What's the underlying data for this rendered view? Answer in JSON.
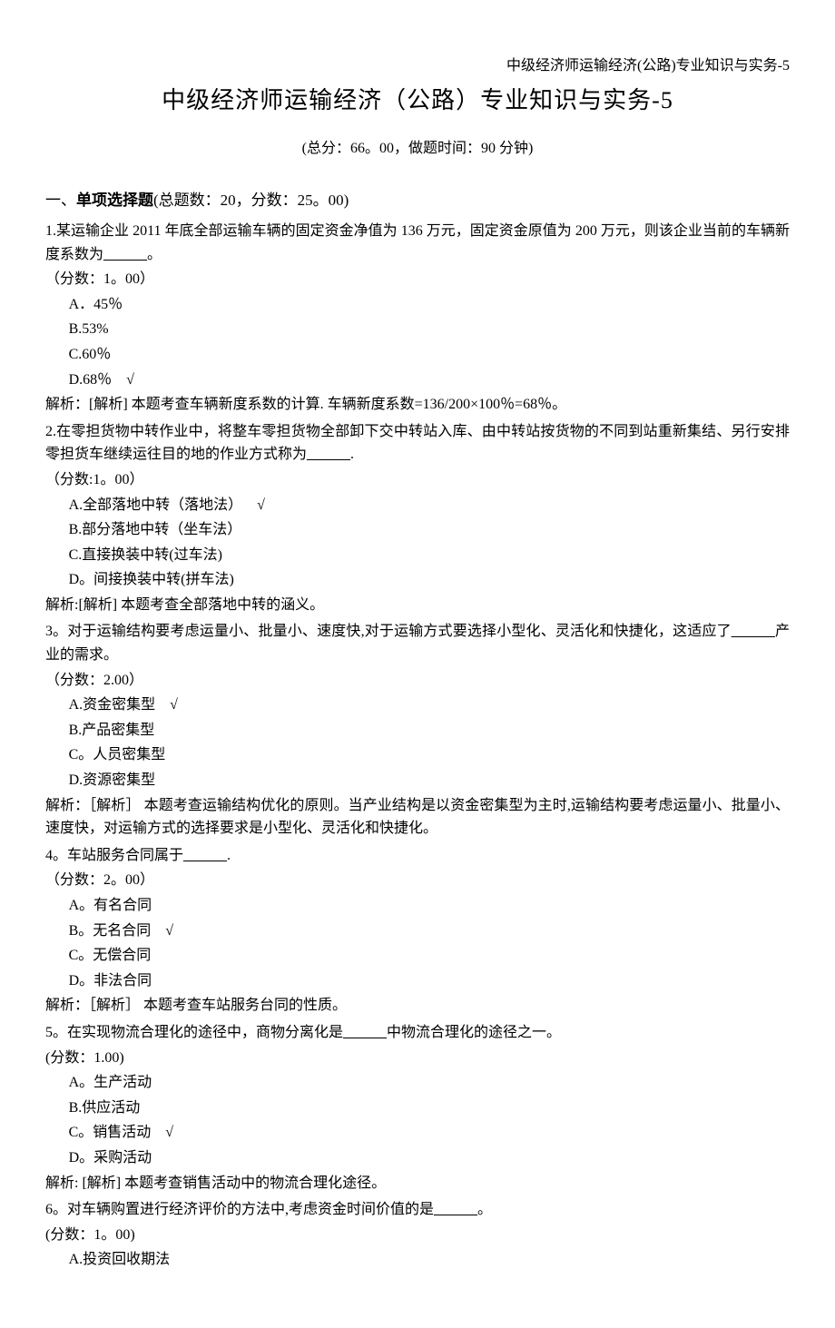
{
  "header_right": "中级经济师运输经济(公路)专业知识与实务-5",
  "title": "中级经济师运输经济（公路）专业知识与实务-5",
  "meta": "(总分：66。00，做题时间：90 分钟)",
  "section_prefix": "一、",
  "section_bold": "单项选择题",
  "section_detail": "(总题数：20，分数：25。00)",
  "check_mark": "√",
  "blank_text": "______",
  "q1": {
    "stem_a": "1.某运输企业 2011 年底全部运输车辆的固定资金净值为 136 万元，固定资金原值为 200 万元，则该企业当前的车辆新度系数为",
    "stem_b": "。",
    "score": "（分数：1。00）",
    "optA": "A．45％",
    "optB": "B.53%",
    "optC": "C.60％",
    "optD": "D.68％",
    "analysis": "解析：[解析] 本题考查车辆新度系数的计算. 车辆新度系数=136/200×100％=68％。"
  },
  "q2": {
    "stem_a": "2.在零担货物中转作业中，将整车零担货物全部卸下交中转站入库、由中转站按货物的不同到站重新集结、另行安排零担货车继续运往目的地的作业方式称为",
    "stem_b": ".",
    "score": "（分数:1。00）",
    "optA": "A.全部落地中转（落地法）",
    "optB": "B.部分落地中转（坐车法）",
    "optC": "C.直接换装中转(过车法)",
    "optD": "D。间接换装中转(拼车法)",
    "analysis": "解析:[解析] 本题考查全部落地中转的涵义。"
  },
  "q3": {
    "stem_a": "3。对于运输结构要考虑运量小、批量小、速度快,对于运输方式要选择小型化、灵活化和快捷化，这适应了",
    "stem_b": "产业的需求。",
    "score": "（分数：2.00）",
    "optA": "A.资金密集型",
    "optB": "B.产品密集型",
    "optC": "C。人员密集型",
    "optD": "D.资源密集型",
    "analysis": "解析：［解析］ 本题考查运输结构优化的原则。当产业结构是以资金密集型为主时,运输结构要考虑运量小、批量小、速度快，对运输方式的选择要求是小型化、灵活化和快捷化。"
  },
  "q4": {
    "stem_a": "4。车站服务合同属于",
    "stem_b": ".",
    "score": "（分数：2。00）",
    "optA": "A。有名合同",
    "optB": "B。无名合同",
    "optC": "C。无偿合同",
    "optD": "D。非法合同",
    "analysis": "解析：［解析］ 本题考查车站服务台同的性质。"
  },
  "q5": {
    "stem_a": "5。在实现物流合理化的途径中，商物分离化是",
    "stem_b": "中物流合理化的途径之一。",
    "score": "(分数：1.00)",
    "optA": "A。生产活动",
    "optB": "B.供应活动",
    "optC": "C。销售活动",
    "optD": "D。采购活动",
    "analysis": "解析: [解析] 本题考查销售活动中的物流合理化途径。"
  },
  "q6": {
    "stem_a": "6。对车辆购置进行经济评价的方法中,考虑资金时间价值的是",
    "stem_b": "。",
    "score": "(分数：1。00)",
    "optA": "A.投资回收期法"
  }
}
